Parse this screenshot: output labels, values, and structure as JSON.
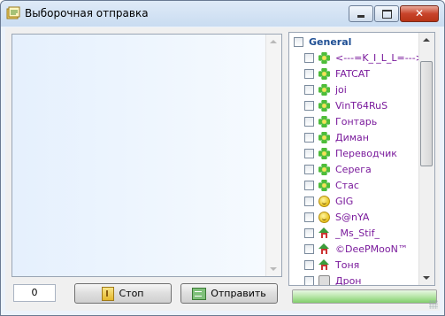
{
  "window": {
    "title": "Выборочная отправка"
  },
  "message": {
    "text": "",
    "counter": "0"
  },
  "buttons": {
    "stop_label": "Стоп",
    "send_label": "Отправить"
  },
  "group": {
    "name": "General",
    "checked": false
  },
  "contacts": [
    {
      "name": "<---=K_I_L_L=--->",
      "status_icon": "flower-icon",
      "checked": false
    },
    {
      "name": "FATCAT",
      "status_icon": "flower-icon",
      "checked": false
    },
    {
      "name": "joi",
      "status_icon": "flower-icon",
      "checked": false
    },
    {
      "name": "VinT64RuS",
      "status_icon": "flower-icon",
      "checked": false
    },
    {
      "name": "Гонтарь",
      "status_icon": "flower-icon",
      "checked": false
    },
    {
      "name": "Диман",
      "status_icon": "flower-icon",
      "checked": false
    },
    {
      "name": "Переводчик",
      "status_icon": "flower-icon",
      "checked": false
    },
    {
      "name": "Серега",
      "status_icon": "flower-icon",
      "checked": false
    },
    {
      "name": "Стас",
      "status_icon": "flower-icon",
      "checked": false
    },
    {
      "name": "GIG",
      "status_icon": "smiley-icon",
      "checked": false
    },
    {
      "name": "S@nYA",
      "status_icon": "smiley-icon",
      "checked": false
    },
    {
      "name": "_Ms_Stif_",
      "status_icon": "house-icon",
      "checked": false
    },
    {
      "name": "©DeePMooN™",
      "status_icon": "house-icon",
      "checked": false
    },
    {
      "name": "Тоня",
      "status_icon": "house-icon",
      "checked": false
    },
    {
      "name": "Дрон",
      "status_icon": "wait-icon",
      "checked": false
    }
  ],
  "progress": {
    "value": 1.0
  },
  "colors": {
    "contact_text": "#7a1a9c",
    "group_text": "#1f4f94",
    "progress": "#82cf6b"
  }
}
